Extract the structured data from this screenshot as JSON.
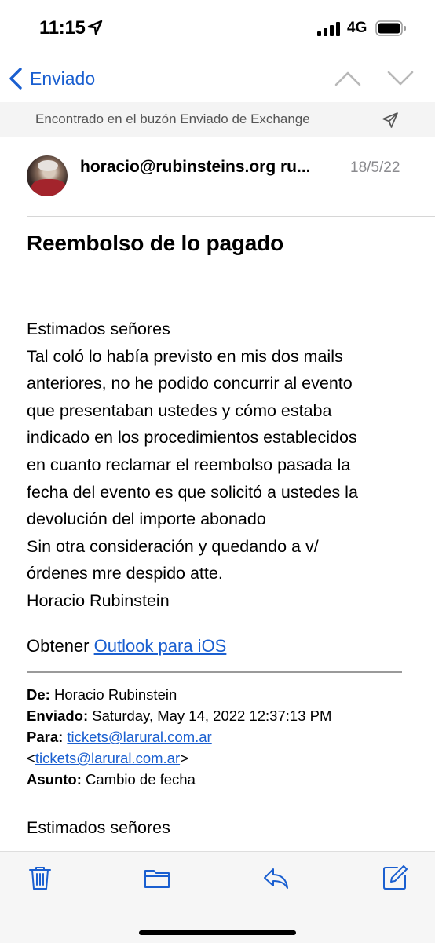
{
  "status": {
    "time": "11:15",
    "network": "4G"
  },
  "nav": {
    "back_label": "Enviado"
  },
  "banner": {
    "text": "Encontrado en el buzón Enviado de Exchange"
  },
  "message": {
    "sender": "horacio@rubinsteins.org ru...",
    "date": "18/5/22",
    "subject": "Reembolso de lo pagado",
    "body_lines": [
      "Estimados señores",
      "Tal coló lo había previsto en mis dos mails",
      "anteriores, no he podido concurrir al evento",
      "que presentaban ustedes y cómo estaba",
      "indicado en los procedimientos establecidos",
      "en cuanto reclamar el reembolso pasada la",
      "fecha del evento es que solicitó a ustedes la",
      "devolución del importe abonado",
      "Sin otra consideración y quedando a v/",
      "órdenes mre despido atte.",
      "Horacio Rubinstein"
    ],
    "outlook_prefix": "Obtener ",
    "outlook_link": "Outlook para iOS",
    "quoted": {
      "from_label": "De:",
      "from_value": "Horacio Rubinstein",
      "sent_label": "Enviado:",
      "sent_value": "Saturday, May 14, 2022 12:37:13 PM",
      "to_label": "Para:",
      "to_link": "tickets@larural.com.ar",
      "to_open": "<",
      "to_link2": "tickets@larural.com.ar",
      "to_close": ">",
      "subject_label": "Asunto:",
      "subject_value": "Cambio de fecha"
    },
    "greeting2": "Estimados señores"
  },
  "colors": {
    "accent": "#1a5fd0"
  },
  "icons": [
    "location-arrow-icon",
    "signal-icon",
    "battery-icon",
    "chevron-left-icon",
    "chevron-up-icon",
    "chevron-down-icon",
    "send-icon",
    "trash-icon",
    "folder-icon",
    "reply-icon",
    "compose-icon"
  ]
}
